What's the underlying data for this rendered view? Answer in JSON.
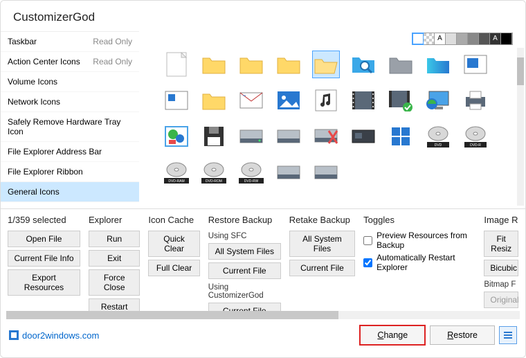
{
  "title": "CustomizerGod",
  "sidebar": [
    {
      "label": "Taskbar",
      "read": "Read Only"
    },
    {
      "label": "Action Center Icons",
      "read": "Read Only"
    },
    {
      "label": "Volume Icons",
      "read": ""
    },
    {
      "label": "Network Icons",
      "read": ""
    },
    {
      "label": "Safely Remove Hardware Tray Icon",
      "read": ""
    },
    {
      "label": "File Explorer Address Bar",
      "read": ""
    },
    {
      "label": "File Explorer Ribbon",
      "read": ""
    },
    {
      "label": "General Icons",
      "read": ""
    }
  ],
  "selected_sidebar": 7,
  "cols": {
    "c1": {
      "title": "1/359 selected",
      "b1": "Open File",
      "b2": "Current File Info",
      "b3": "Export Resources"
    },
    "c2": {
      "title": "Explorer",
      "b1": "Run",
      "b2": "Exit",
      "b3": "Force Close",
      "b4": "Restart"
    },
    "c3": {
      "title": "Icon Cache",
      "b1": "Quick Clear",
      "b2": "Full Clear"
    },
    "c4": {
      "title": "Restore Backup",
      "s1": "Using SFC",
      "b1": "All System Files",
      "b2": "Current File",
      "s2": "Using CustomizerGod",
      "b3": "Current File"
    },
    "c5": {
      "title": "Retake Backup",
      "b1": "All System Files",
      "b2": "Current File"
    },
    "c6": {
      "title": "Toggles",
      "t1": "Preview Resources from Backup",
      "t2": "Automatically Restart Explorer"
    },
    "c7": {
      "title": "Image R",
      "b1": "Fit Resiz",
      "b2": "Bicubic",
      "s1": "Bitmap F",
      "b3": "Original"
    }
  },
  "footer": {
    "link": "door2windows.com",
    "change": "Change",
    "restore": "Restore"
  }
}
